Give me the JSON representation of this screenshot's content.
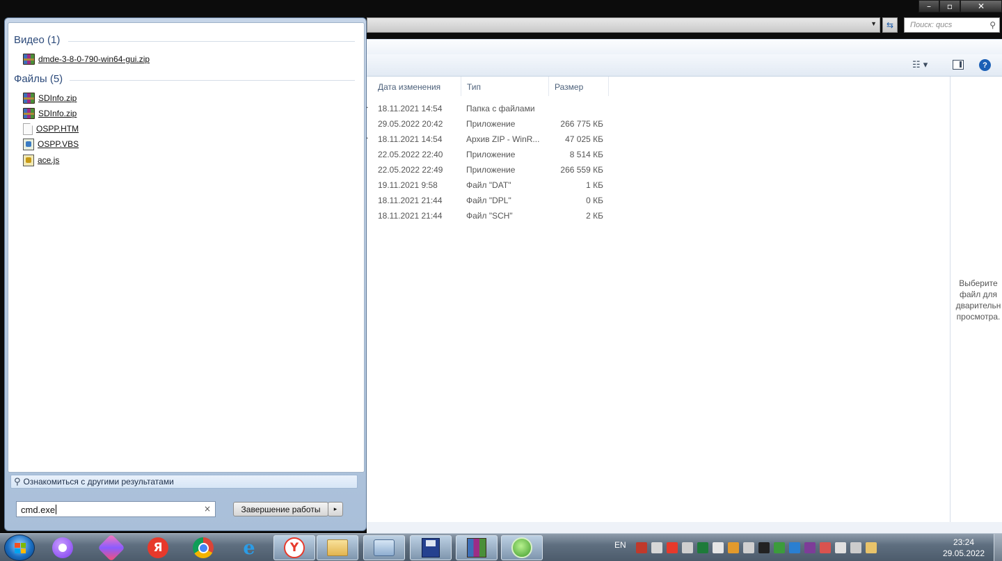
{
  "explorer": {
    "window_controls": {
      "minimize": "–",
      "maximize": "▫",
      "close": "✕"
    },
    "search_placeholder": "Поиск: qucs",
    "columns": {
      "date": "Дата изменения",
      "type": "Тип",
      "size": "Размер"
    },
    "rows": [
      {
        "date": "18.11.2021 14:54",
        "type": "Папка с файлами",
        "size": ""
      },
      {
        "date": "29.05.2022 20:42",
        "type": "Приложение",
        "size": "266 775 КБ"
      },
      {
        "date": "18.11.2021 14:54",
        "type": "Архив ZIP - WinR...",
        "size": "47 025 КБ"
      },
      {
        "date": "22.05.2022 22:40",
        "type": "Приложение",
        "size": "8 514 КБ"
      },
      {
        "date": "22.05.2022 22:49",
        "type": "Приложение",
        "size": "266 559 КБ"
      },
      {
        "date": "19.11.2021 9:58",
        "type": "Файл \"DAT\"",
        "size": "1 КБ"
      },
      {
        "date": "18.11.2021 21:44",
        "type": "Файл \"DPL\"",
        "size": "0 КБ"
      },
      {
        "date": "18.11.2021 21:44",
        "type": "Файл \"SCH\"",
        "size": "2 КБ"
      }
    ],
    "preview_message": {
      "line1": "Выберите",
      "line2": "файл для",
      "line3": "дварительн",
      "line4": "просмотра."
    },
    "help_label": "?"
  },
  "start_menu": {
    "sections": [
      {
        "heading": "Видео (1)",
        "items": [
          {
            "label": "dmde-3-8-0-790-win64-gui.zip",
            "icon": "zip-icon"
          }
        ]
      },
      {
        "heading": "Файлы (5)",
        "items": [
          {
            "label": "SDInfo.zip",
            "icon": "zip-icon"
          },
          {
            "label": "SDInfo.zip",
            "icon": "zip-icon"
          },
          {
            "label": "OSPP.HTM",
            "icon": "htm-file-icon"
          },
          {
            "label": "OSPP.VBS",
            "icon": "vbs-script-icon"
          },
          {
            "label": "ace.js",
            "icon": "js-script-icon"
          }
        ]
      }
    ],
    "more_results": "Ознакомиться с другими результатами",
    "search_value": "cmd.exe",
    "clear_icon": "×",
    "shutdown_label": "Завершение работы",
    "shutdown_arrow": "▸"
  },
  "taskbar": {
    "apps": [
      "start-orb",
      "alice",
      "gem-app",
      "yandex",
      "chrome",
      "internet-explorer",
      "yandex-browser",
      "explorer-folder",
      "remote-desktop",
      "save-app",
      "winrar",
      "search-app"
    ],
    "lang": "EN",
    "time": "23:24",
    "date": "29.05.2022",
    "tray_colors": [
      "#c0392b",
      "#d7d7d7",
      "#e7392b",
      "#cfcfcf",
      "#1e7b3a",
      "#e6e6e6",
      "#e39a2b",
      "#d0d0d0",
      "#222222",
      "#3c9b3c",
      "#2a7fd1",
      "#7d3c98",
      "#d9534f",
      "#e0e0e0",
      "#cccccc",
      "#e8c36a"
    ]
  }
}
